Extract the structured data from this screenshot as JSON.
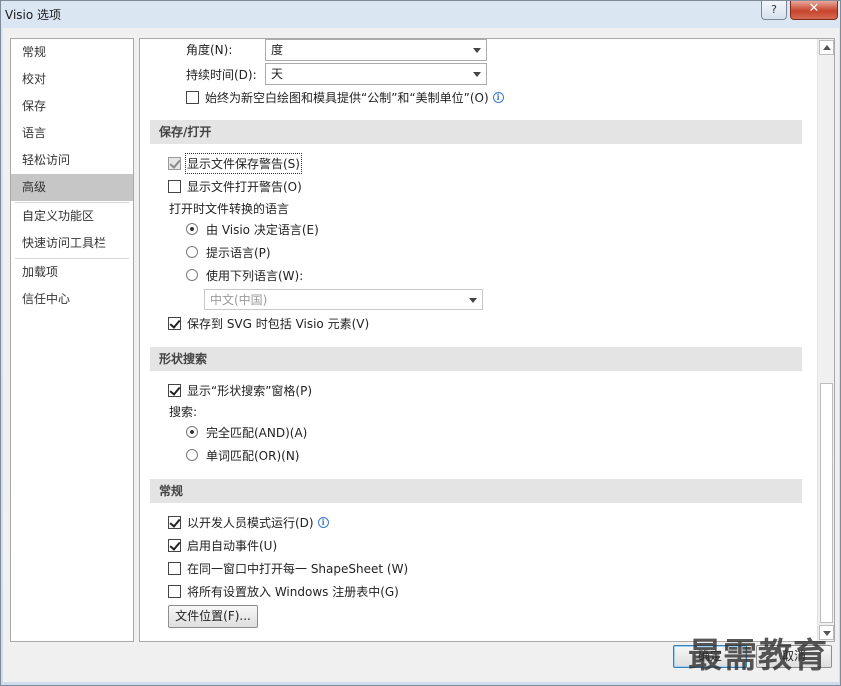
{
  "window": {
    "title": "Visio 选项",
    "help_label": "?",
    "close_label": "✕"
  },
  "nav": {
    "items": [
      {
        "label": "常规"
      },
      {
        "label": "校对"
      },
      {
        "label": "保存"
      },
      {
        "label": "语言"
      },
      {
        "label": "轻松访问"
      },
      {
        "label": "高级",
        "selected": true
      },
      {
        "label": "自定义功能区"
      },
      {
        "label": "快速访问工具栏"
      },
      {
        "label": "加载项"
      },
      {
        "label": "信任中心"
      }
    ]
  },
  "units": {
    "angle_label": "角度(N):",
    "angle_value": "度",
    "duration_label": "持续时间(D):",
    "duration_value": "天",
    "always_units_label": "始终为新空白绘图和模具提供“公制”和“美制单位”(O)",
    "always_units_checked": false
  },
  "save_open": {
    "header": "保存/打开",
    "show_save_warning_label": "显示文件保存警告(S)",
    "show_save_warning_checked": true,
    "show_open_warning_label": "显示文件打开警告(O)",
    "show_open_warning_checked": false,
    "convert_language_label": "打开时文件转换的语言",
    "radio_visio_label": "由 Visio 决定语言(E)",
    "radio_prompt_label": "提示语言(P)",
    "radio_use_label": "使用下列语言(W):",
    "selected_radio": "visio",
    "language_value": "中文(中国)",
    "svg_label": "保存到 SVG 时包括 Visio 元素(V)",
    "svg_checked": true
  },
  "shape_search": {
    "header": "形状搜索",
    "show_pane_label": "显示“形状搜索”窗格(P)",
    "show_pane_checked": true,
    "search_label": "搜索:",
    "radio_all_label": "完全匹配(AND)(A)",
    "radio_any_label": "单词匹配(OR)(N)",
    "selected_radio": "all"
  },
  "general": {
    "header": "常规",
    "dev_mode_label": "以开发人员模式运行(D)",
    "dev_mode_checked": true,
    "auto_events_label": "启用自动事件(U)",
    "auto_events_checked": true,
    "shapesheet_label": "在同一窗口中打开每一 ShapeSheet (W)",
    "shapesheet_checked": false,
    "registry_label": "将所有设置放入 Windows 注册表中(G)",
    "registry_checked": false,
    "file_locations_button": "文件位置(F)..."
  },
  "footer": {
    "ok_label": "确定",
    "cancel_label": "取消"
  },
  "watermark_text": "最需教育"
}
